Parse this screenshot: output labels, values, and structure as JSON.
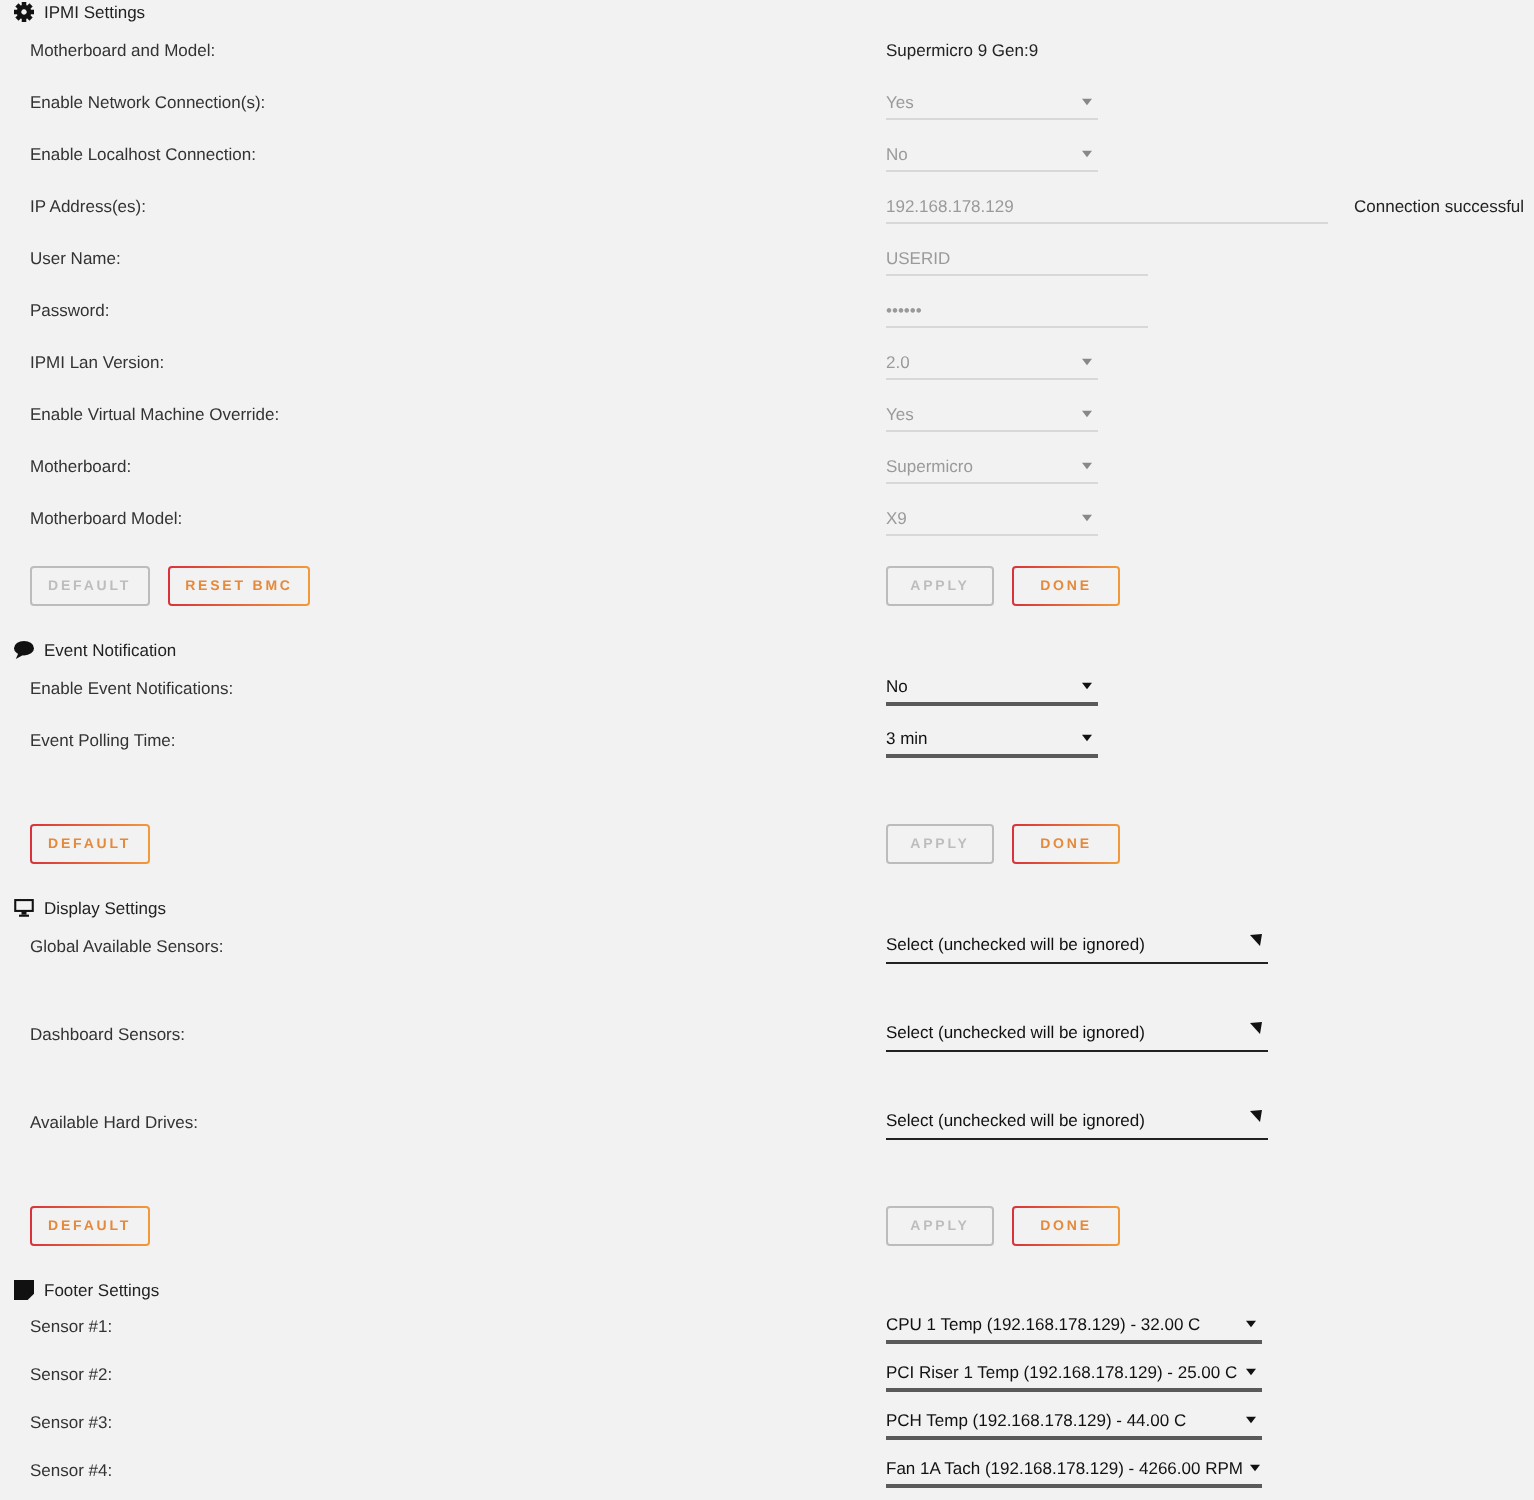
{
  "sections": [
    {
      "title": "IPMI Settings",
      "rows": [
        {
          "label": "Motherboard and Model:",
          "kind": "static",
          "value": "Supermicro 9 Gen:9",
          "disabled": false
        },
        {
          "label": "Enable Network Connection(s):",
          "kind": "select",
          "value": "Yes",
          "disabled": true
        },
        {
          "label": "Enable Localhost Connection:",
          "kind": "select",
          "value": "No",
          "disabled": true
        },
        {
          "label": "IP Address(es):",
          "kind": "input",
          "value": "192.168.178.129",
          "disabled": true,
          "status": "Connection successful"
        },
        {
          "label": "User Name:",
          "kind": "input",
          "value": "USERID",
          "disabled": true
        },
        {
          "label": "Password:",
          "kind": "input",
          "value": "••••••",
          "disabled": true
        },
        {
          "label": "IPMI Lan Version:",
          "kind": "select",
          "value": "2.0",
          "disabled": true
        },
        {
          "label": "Enable Virtual Machine Override:",
          "kind": "select",
          "value": "Yes",
          "disabled": true
        },
        {
          "label": "Motherboard:",
          "kind": "select",
          "value": "Supermicro",
          "disabled": true
        },
        {
          "label": "Motherboard Model:",
          "kind": "select",
          "value": "X9",
          "disabled": true
        }
      ],
      "buttons_left": [
        {
          "label": "DEFAULT",
          "disabled": true
        },
        {
          "label": "RESET BMC",
          "disabled": false
        }
      ],
      "buttons_right": [
        {
          "label": "APPLY",
          "disabled": true
        },
        {
          "label": "DONE",
          "disabled": false
        }
      ]
    },
    {
      "title": "Event Notification",
      "rows": [
        {
          "label": "Enable Event Notifications:",
          "kind": "select",
          "value": "No",
          "disabled": false
        },
        {
          "label": "Event Polling Time:",
          "kind": "select",
          "value": "3 min",
          "disabled": false
        }
      ],
      "buttons_left": [
        {
          "label": "DEFAULT",
          "disabled": false
        }
      ],
      "buttons_right": [
        {
          "label": "APPLY",
          "disabled": true
        },
        {
          "label": "DONE",
          "disabled": false
        }
      ]
    },
    {
      "title": "Display Settings",
      "rows": [
        {
          "label": "Global Available Sensors:",
          "kind": "multiselect",
          "value": "Select (unchecked will be ignored)",
          "disabled": false
        },
        {
          "label": "Dashboard Sensors:",
          "kind": "multiselect",
          "value": "Select (unchecked will be ignored)",
          "disabled": false
        },
        {
          "label": "Available Hard Drives:",
          "kind": "multiselect",
          "value": "Select (unchecked will be ignored)",
          "disabled": false
        }
      ],
      "buttons_left": [
        {
          "label": "DEFAULT",
          "disabled": false
        }
      ],
      "buttons_right": [
        {
          "label": "APPLY",
          "disabled": true
        },
        {
          "label": "DONE",
          "disabled": false
        }
      ]
    },
    {
      "title": "Footer Settings",
      "rows": [
        {
          "label": "Sensor #1:",
          "kind": "sensor",
          "value": "CPU 1 Temp (192.168.178.129) - 32.00 C",
          "disabled": false
        },
        {
          "label": "Sensor #2:",
          "kind": "sensor",
          "value": "PCI Riser 1 Temp (192.168.178.129) - 25.00 C",
          "disabled": false
        },
        {
          "label": "Sensor #3:",
          "kind": "sensor",
          "value": "PCH Temp (192.168.178.129) - 44.00 C",
          "disabled": false
        },
        {
          "label": "Sensor #4:",
          "kind": "sensor",
          "value": "Fan 1A Tach (192.168.178.129) - 4266.00 RPM",
          "disabled": false
        }
      ]
    }
  ]
}
